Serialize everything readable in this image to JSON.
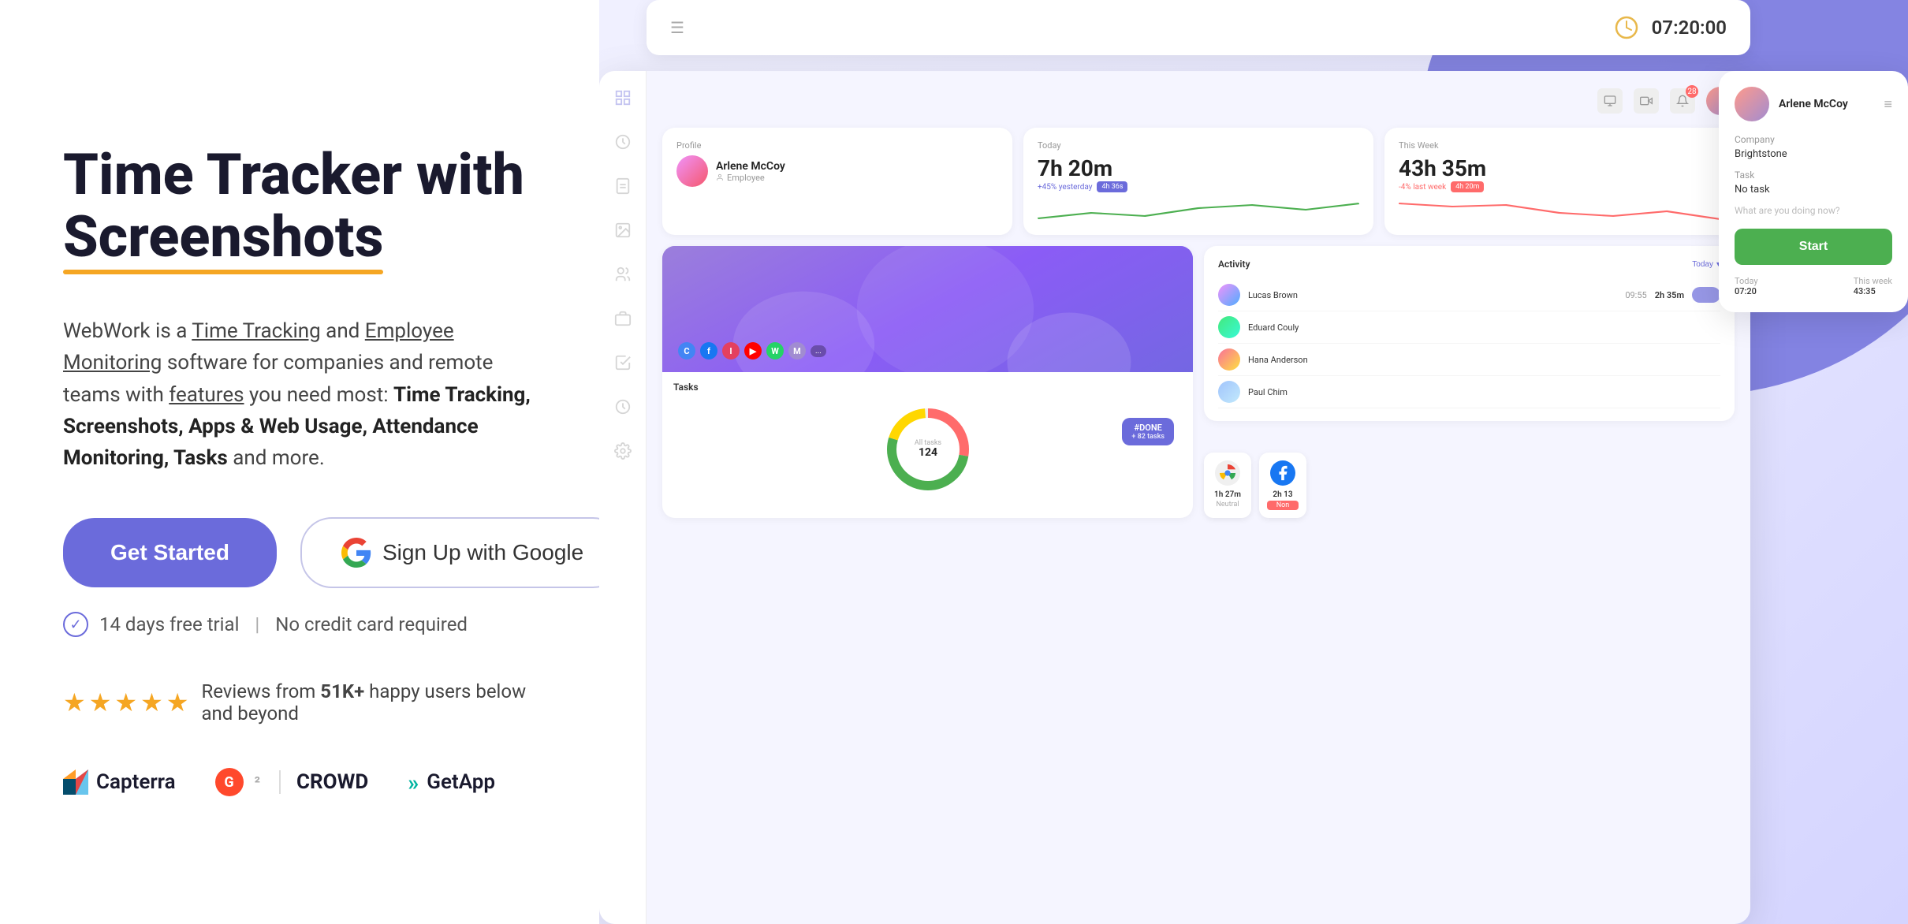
{
  "headline": {
    "line1": "Time Tracker with",
    "line2": "Screenshots",
    "underline": "Screenshots"
  },
  "description": {
    "intro": "WebWork is a ",
    "link1": "Time Tracking",
    "and": " and ",
    "link2": "Employee Monitoring",
    "mid": " software for companies and remote teams with ",
    "link3": "features",
    "end": " you need most: ",
    "bold": "Time Tracking, Screenshots, Apps & Web Usage, Attendance Monitoring, Tasks",
    "tail": " and more."
  },
  "cta": {
    "get_started": "Get Started",
    "google": "Sign Up with Google"
  },
  "trial": {
    "text": "14 days free trial",
    "separator": "|",
    "no_card": "No credit card required"
  },
  "reviews": {
    "text": "Reviews from ",
    "count": "51K+",
    "tail": " happy users below and beyond"
  },
  "logos": {
    "capterra": "Capterra",
    "g2": "CROWD",
    "getapp": "GetApp"
  },
  "dashboard": {
    "timer": "07:20:00",
    "profile": {
      "label": "Profile",
      "name": "Arlene McCoy",
      "role": "Employee"
    },
    "today": {
      "label": "Today",
      "time": "7h 20m",
      "sub": "+45% yesterday",
      "tag": "4h 36s"
    },
    "this_week": {
      "label": "This Week",
      "time": "43h 35m",
      "sub": "-4% last week",
      "tag": "4h 20m"
    },
    "activity": {
      "label": "Activity",
      "filter": "Today",
      "users": [
        {
          "name": "Lucas Brown",
          "time": "09:55",
          "duration": "2h 35m"
        },
        {
          "name": "Eduard Couly",
          "time": "",
          "duration": ""
        },
        {
          "name": "Hana Anderson",
          "time": "",
          "duration": ""
        },
        {
          "name": "Paul Chim",
          "time": "",
          "duration": ""
        }
      ]
    },
    "tasks": {
      "label": "Tasks",
      "total": "All tasks 124",
      "done_label": "#DONE",
      "done_sub": "+ 82 tasks"
    },
    "widget": {
      "name": "Arlene McCoy",
      "company": "Brightstone",
      "task": "No task",
      "placeholder": "What are you doing now?",
      "start": "Start",
      "today_label": "Today",
      "today_val": "07:20",
      "week_label": "This week",
      "week_val": "43:35"
    },
    "apps": {
      "chrome_time": "1h 27m",
      "chrome_label": "Neutral",
      "fb_time": "2h 13",
      "fb_label": "Non"
    }
  }
}
